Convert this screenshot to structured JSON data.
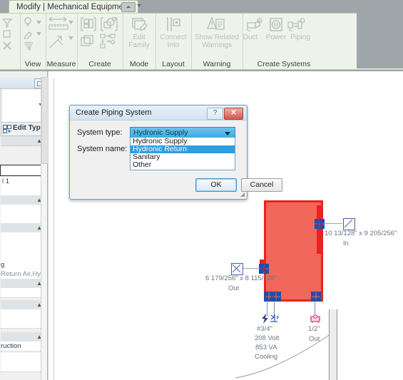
{
  "ribbon": {
    "tab_label": "Modify | Mechanical Equipment",
    "minimize_icon": "ribbon-minimize-icon",
    "panels": [
      {
        "name": "view",
        "label": "View"
      },
      {
        "name": "measure",
        "label": "Measure"
      },
      {
        "name": "create",
        "label": "Create"
      },
      {
        "name": "mode",
        "label": "Mode"
      },
      {
        "name": "layout",
        "label": "Layout"
      },
      {
        "name": "warning",
        "label": "Warning"
      },
      {
        "name": "create-systems",
        "label": "Create Systems"
      }
    ],
    "buttons": {
      "edit_family": "Edit\nFamily",
      "edit_family_l1": "Edit",
      "edit_family_l2": "Family",
      "connect_into_l1": "Connect",
      "connect_into_l2": "Into",
      "show_related_warnings_l1": "Show Related",
      "show_related_warnings_l2": "Warnings",
      "duct": "Duct",
      "power": "Power",
      "piping": "Piping"
    }
  },
  "properties_palette": {
    "edit_type_label": "Edit Type",
    "rows": [
      {
        "text": "l 1"
      },
      {
        "text": "g"
      },
      {
        "text": "Return Air,Hy..."
      },
      {
        "text": "ruction"
      }
    ]
  },
  "dialog": {
    "title": "Create Piping System",
    "help_glyph": "?",
    "close_glyph": "✕",
    "labels": {
      "system_type": "System type:",
      "system_name": "System name:"
    },
    "system_type_value": "Hydronic Supply",
    "system_name_value": "",
    "dropdown_options": [
      "Hydronic Supply",
      "Hydronic Return",
      "Sanitary",
      "Other"
    ],
    "dropdown_selected_index": 1,
    "ok_label": "OK",
    "cancel_label": "Cancel",
    "resize_grip": "◢"
  },
  "canvas": {
    "equipment_fill": "#f2675c",
    "equipment_stroke": "#e8231c",
    "annotations": [
      {
        "name": "duct-in",
        "size": "10 13/128\" x 9 205/256\"",
        "flow": "In"
      },
      {
        "name": "duct-out",
        "size": "6 179/256\" x 8 115/128\"",
        "flow": "Out"
      },
      {
        "name": "electrical",
        "size": "#3/4\"",
        "line2": "208 Volt",
        "line3": "853 VA",
        "line4": "Cooling"
      },
      {
        "name": "pipe-out",
        "size": "1/2\"",
        "flow": "Out"
      }
    ]
  }
}
